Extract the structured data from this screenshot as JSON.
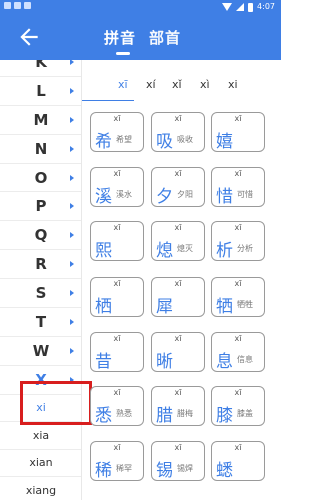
{
  "status_bar": {
    "time": "4:07"
  },
  "header": {
    "tabs": [
      "拼音",
      "部首"
    ],
    "active_tab": 0
  },
  "sidebar": {
    "letters": [
      "K",
      "L",
      "M",
      "N",
      "O",
      "P",
      "Q",
      "R",
      "S",
      "T",
      "W",
      "X"
    ],
    "sub_items": [
      "xi",
      "xia",
      "xian",
      "xiang"
    ],
    "selected_sub": "xi"
  },
  "pinyin_tabs": [
    "xī",
    "xí",
    "xǐ",
    "xì",
    "xi"
  ],
  "active_pinyin_tab": 0,
  "cards": [
    {
      "py": "xī",
      "ch": "希",
      "word": "希望"
    },
    {
      "py": "xī",
      "ch": "吸",
      "word": "吸收"
    },
    {
      "py": "xī",
      "ch": "嬉",
      "word": ""
    },
    {
      "py": "xī",
      "ch": "溪",
      "word": "溪水"
    },
    {
      "py": "xī",
      "ch": "夕",
      "word": "夕阳"
    },
    {
      "py": "xī",
      "ch": "惜",
      "word": "可惜"
    },
    {
      "py": "xī",
      "ch": "熙",
      "word": ""
    },
    {
      "py": "xī",
      "ch": "熄",
      "word": "熄灭"
    },
    {
      "py": "xī",
      "ch": "析",
      "word": "分析"
    },
    {
      "py": "xī",
      "ch": "栖",
      "word": ""
    },
    {
      "py": "xī",
      "ch": "犀",
      "word": ""
    },
    {
      "py": "xī",
      "ch": "牺",
      "word": "牺牲"
    },
    {
      "py": "xī",
      "ch": "昔",
      "word": ""
    },
    {
      "py": "xī",
      "ch": "晰",
      "word": ""
    },
    {
      "py": "xī",
      "ch": "息",
      "word": "信息"
    },
    {
      "py": "xī",
      "ch": "悉",
      "word": "熟悉"
    },
    {
      "py": "xī",
      "ch": "腊",
      "word": "腊梅"
    },
    {
      "py": "xī",
      "ch": "膝",
      "word": "膝盖"
    },
    {
      "py": "xī",
      "ch": "稀",
      "word": "稀罕"
    },
    {
      "py": "xī",
      "ch": "锡",
      "word": "锡焊"
    },
    {
      "py": "xī",
      "ch": "蟋",
      "word": ""
    }
  ],
  "colors": {
    "accent": "#3f7fe5",
    "highlight_box": "#d81e1e"
  }
}
